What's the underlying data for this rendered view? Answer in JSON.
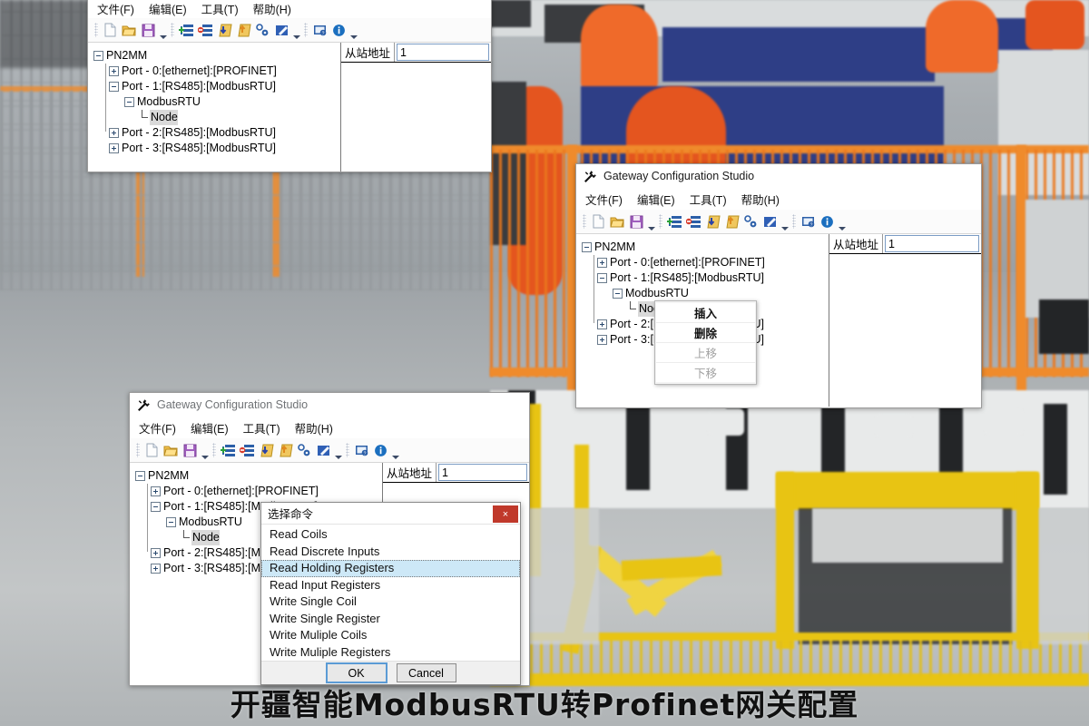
{
  "app": {
    "title": "Gateway Configuration Studio",
    "window_icon": "hammer-wrench-icon",
    "menu": [
      {
        "label": "文件(F)",
        "name": "menu-file"
      },
      {
        "label": "编辑(E)",
        "name": "menu-edit"
      },
      {
        "label": "工具(T)",
        "name": "menu-tools"
      },
      {
        "label": "帮助(H)",
        "name": "menu-help"
      }
    ],
    "toolbar": [
      {
        "name": "new-file-icon",
        "tip": "新建"
      },
      {
        "name": "open-folder-icon",
        "tip": "打开"
      },
      {
        "name": "save-icon",
        "tip": "保存"
      },
      {
        "name": "add-node-icon",
        "tip": "添加"
      },
      {
        "name": "remove-node-icon",
        "tip": "删除"
      },
      {
        "name": "download-icon",
        "tip": "下载"
      },
      {
        "name": "upload-icon",
        "tip": "上传"
      },
      {
        "name": "settings-gear-icon",
        "tip": "设置"
      },
      {
        "name": "edit-pencil-icon",
        "tip": "编辑"
      },
      {
        "name": "help-monitor-icon",
        "tip": "帮助"
      },
      {
        "name": "about-info-icon",
        "tip": "关于"
      }
    ]
  },
  "tree": {
    "root": "PN2MM",
    "nodes": [
      {
        "label": "Port - 0:[ethernet]:[PROFINET]",
        "depth": 1,
        "toggle": "plus"
      },
      {
        "label": "Port - 1:[RS485]:[ModbusRTU]",
        "depth": 1,
        "toggle": "minus"
      },
      {
        "label": "ModbusRTU",
        "depth": 2,
        "toggle": "minus"
      },
      {
        "label": "Node",
        "depth": 3,
        "toggle": "leaf",
        "selected": true
      },
      {
        "label": "Port - 2:[RS485]:[ModbusRTU]",
        "depth": 1,
        "toggle": "plus"
      },
      {
        "label": "Port - 3:[RS485]:[ModbusRTU]",
        "depth": 1,
        "toggle": "plus"
      }
    ]
  },
  "right_panel": {
    "slave_address_label": "从站地址",
    "slave_address_value": "1"
  },
  "context_menu": {
    "items": [
      {
        "label": "插入",
        "disabled": false
      },
      {
        "label": "删除",
        "disabled": false
      },
      {
        "label": "上移",
        "disabled": true
      },
      {
        "label": "下移",
        "disabled": true
      }
    ]
  },
  "dialog": {
    "title": "选择命令",
    "close_label": "×",
    "options": [
      "Read Coils",
      "Read Discrete Inputs",
      "Read Holding Registers",
      "Read Input Registers",
      "Write Single Coil",
      "Write Single Register",
      "Write Muliple Coils",
      "Write Muliple Registers"
    ],
    "selected_option": "Read Holding Registers",
    "ok_label": "OK",
    "cancel_label": "Cancel"
  },
  "caption": "开疆智能ModbusRTU转Profinet网关配置",
  "colors": {
    "selection": "#cde8f7",
    "close_button": "#c0392b",
    "default_button_border": "#5b9bd5",
    "robot_orange": "#e4551f",
    "fence_yellow": "#e8c413"
  }
}
